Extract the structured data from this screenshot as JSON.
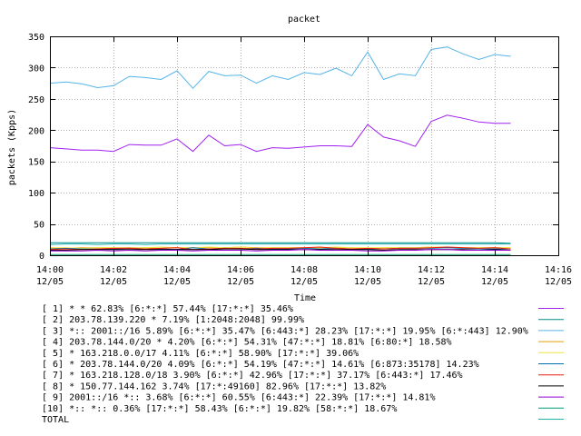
{
  "chart_data": {
    "type": "line",
    "title": "packet",
    "xlabel": "Time",
    "ylabel": "packets (Kpps)",
    "ylim": [
      0,
      350
    ],
    "yticks": [
      0,
      50,
      100,
      150,
      200,
      250,
      300,
      350
    ],
    "xticks": [
      {
        "t": 0,
        "l1": "14:00",
        "l2": "12/05"
      },
      {
        "t": 2,
        "l1": "14:02",
        "l2": "12/05"
      },
      {
        "t": 4,
        "l1": "14:04",
        "l2": "12/05"
      },
      {
        "t": 6,
        "l1": "14:06",
        "l2": "12/05"
      },
      {
        "t": 8,
        "l1": "14:08",
        "l2": "12/05"
      },
      {
        "t": 10,
        "l1": "14:10",
        "l2": "12/05"
      },
      {
        "t": 12,
        "l1": "14:12",
        "l2": "12/05"
      },
      {
        "t": 14,
        "l1": "14:14",
        "l2": "12/05"
      },
      {
        "t": 16,
        "l1": "14:16",
        "l2": "12/05"
      }
    ],
    "xlim": [
      0,
      16
    ],
    "grid": true,
    "legend_position": "bottom",
    "x": [
      0,
      0.5,
      1,
      1.5,
      2,
      2.5,
      3,
      3.5,
      4,
      4.5,
      5,
      5.5,
      6,
      6.5,
      7,
      7.5,
      8,
      8.5,
      9,
      9.5,
      10,
      10.5,
      11,
      11.5,
      12,
      12.5,
      13,
      13.5,
      14,
      14.5
    ],
    "series": [
      {
        "name": "[ 1] * * 62.83%  [6:*:*] 57.44% [17:*:*] 35.46%",
        "color": "#a020f0",
        "values": [
          172,
          170,
          168,
          168,
          166,
          177,
          176,
          176,
          186,
          166,
          192,
          175,
          177,
          166,
          172,
          171,
          173,
          175,
          175,
          174,
          209,
          189,
          183,
          174,
          214,
          224,
          219,
          213,
          211,
          211
        ]
      },
      {
        "name": "[ 2] 203.78.139.220 * 7.19%  [1:2048:2048] 99.99%",
        "color": "#008b8b",
        "values": [
          20,
          20,
          20,
          20,
          20,
          20,
          20,
          20,
          20,
          20,
          20,
          20,
          20,
          20,
          20,
          20,
          20,
          20,
          20,
          20,
          20,
          20,
          20,
          20,
          20,
          20,
          20,
          20,
          20,
          19
        ]
      },
      {
        "name": "[ 3] *:: 2001::/16 5.89%  [6:*:*] 35.47% [6:443:*] 28.23% [17:*:*] 19.95% [6:*:443] 12.90%",
        "color": "#56b4e9",
        "values": [
          275,
          277,
          274,
          268,
          271,
          286,
          284,
          281,
          295,
          267,
          294,
          287,
          288,
          275,
          287,
          281,
          292,
          289,
          299,
          287,
          325,
          281,
          290,
          287,
          329,
          333,
          322,
          313,
          321,
          318
        ]
      },
      {
        "name": "[ 4] 203.78.144.0/20 * 4.20%  [6:*:*] 54.31% [47:*:*] 18.81% [6:80:*] 18.58%",
        "color": "#e69f00",
        "values": [
          12,
          11,
          12,
          12,
          12,
          12,
          12,
          11,
          12,
          12,
          12,
          12,
          13,
          12,
          12,
          12,
          12,
          12,
          12,
          12,
          11,
          12,
          12,
          12,
          13,
          12,
          12,
          12,
          12,
          12
        ]
      },
      {
        "name": "[ 5] * 163.218.0.0/17 4.11%  [6:*:*] 58.90% [17:*:*] 39.06%",
        "color": "#f0e442",
        "values": [
          12,
          12,
          11,
          12,
          12,
          11,
          12,
          13,
          12,
          12,
          13,
          12,
          13,
          11,
          12,
          12,
          12,
          12,
          13,
          12,
          12,
          12,
          12,
          12,
          13,
          13,
          12,
          12,
          12,
          12
        ]
      },
      {
        "name": "[ 6] * 203.78.144.0/20 4.09%  [6:*:*] 54.19% [47:*:*] 14.61% [6:873:35178] 14.23%",
        "color": "#0072b2",
        "values": [
          10,
          11,
          10,
          10,
          10,
          11,
          10,
          10,
          9,
          12,
          10,
          11,
          10,
          11,
          10,
          10,
          11,
          10,
          11,
          10,
          10,
          10,
          11,
          11,
          11,
          12,
          11,
          10,
          10,
          10
        ]
      },
      {
        "name": "[ 7] * 163.218.128.0/18 3.90%  [6:*:*] 42.96% [17:*:*] 37.17% [6:443:*] 17.46%",
        "color": "#e51e10",
        "values": [
          9,
          10,
          9,
          10,
          11,
          11,
          10,
          11,
          12,
          9,
          10,
          11,
          11,
          10,
          11,
          11,
          12,
          13,
          11,
          10,
          11,
          10,
          11,
          11,
          12,
          13,
          12,
          11,
          12,
          10
        ]
      },
      {
        "name": "[ 8] * 150.77.144.162 3.74%  [17:*:49160] 82.96% [17:*:*] 13.82%",
        "color": "#000000",
        "values": [
          8,
          8,
          9,
          9,
          9,
          9,
          9,
          9,
          9,
          9,
          9,
          10,
          10,
          9,
          9,
          9,
          9,
          9,
          9,
          9,
          9,
          8,
          9,
          9,
          9,
          9,
          9,
          8,
          9,
          8
        ]
      },
      {
        "name": "[ 9] 2001::/16 *:: 3.68%  [6:*:*] 60.55% [6:443:*] 22.39% [17:*:*] 14.81%",
        "color": "#9400d3",
        "values": [
          7,
          7,
          7,
          8,
          7,
          8,
          7,
          8,
          8,
          7,
          8,
          8,
          8,
          7,
          8,
          8,
          9,
          8,
          8,
          8,
          7,
          7,
          8,
          8,
          9,
          9,
          8,
          8,
          8,
          8
        ]
      },
      {
        "name": "[10] *:: *:: 0.36%  [17:*:*] 58.43% [6:*:*] 19.82% [58:*:*] 18.67%",
        "color": "#009e73",
        "values": [
          1,
          1,
          1,
          1,
          1,
          1,
          1,
          1,
          1,
          1,
          1,
          1,
          1,
          1,
          1,
          1,
          1,
          1,
          1,
          1,
          1,
          1,
          1,
          1,
          1,
          1,
          1,
          1,
          1,
          1
        ]
      },
      {
        "name": "TOTAL",
        "color": "#20b2aa",
        "values": [
          17,
          18,
          18,
          17,
          18,
          18,
          17,
          18,
          18,
          18,
          18,
          18,
          18,
          18,
          18,
          18,
          18,
          18,
          18,
          18,
          18,
          18,
          18,
          18,
          18,
          18,
          18,
          18,
          18,
          18
        ]
      }
    ]
  }
}
